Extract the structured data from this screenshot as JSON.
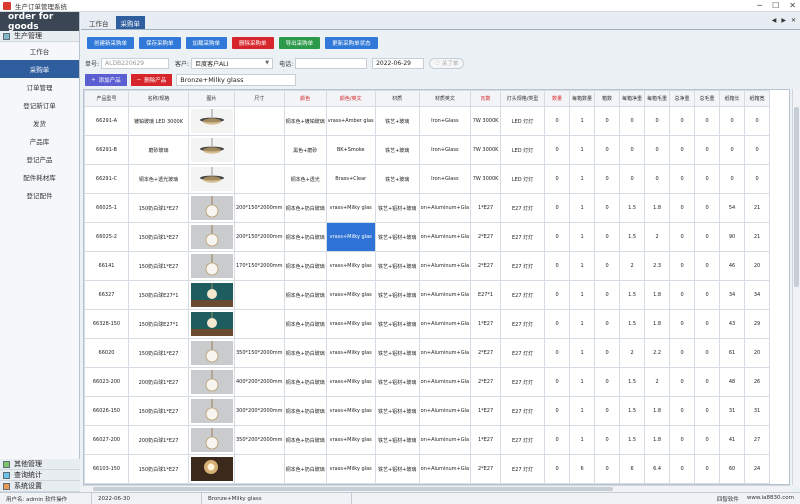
{
  "window": {
    "title": "生产订单管理系统"
  },
  "sidebar": {
    "brand": "order for goods",
    "group_main": "生产管理",
    "items": [
      {
        "label": "工作台"
      },
      {
        "label": "采购单"
      },
      {
        "label": "订单管理"
      },
      {
        "label": "登记新订单"
      },
      {
        "label": "发货"
      },
      {
        "label": "产品库"
      },
      {
        "label": "登记产品"
      },
      {
        "label": "配件耗材库"
      },
      {
        "label": "登记配件"
      }
    ],
    "bottom_groups": [
      {
        "label": "其他管理"
      },
      {
        "label": "查询统计"
      },
      {
        "label": "系统设置"
      }
    ]
  },
  "tabs": [
    {
      "label": "工作台"
    },
    {
      "label": "采购单"
    }
  ],
  "toolbar": {
    "buttons": [
      {
        "label": "创建新采购单"
      },
      {
        "label": "保存采购单"
      },
      {
        "label": "加载采购单"
      },
      {
        "label": "删除采购单"
      },
      {
        "label": "导出采购单"
      },
      {
        "label": "更新采购单状态"
      }
    ]
  },
  "form": {
    "order_no_label": "单号:",
    "order_no_value": "ALDB220629",
    "customer_label": "客户:",
    "customer_value": "巨度客户ALI",
    "phone_label": "电话:",
    "phone_value": "",
    "date_value": "2022-06-29",
    "done_button": "关了单"
  },
  "product": {
    "add_button": "添加产品",
    "delete_button": "删除产品",
    "current_value": "Bronze+Milky glass"
  },
  "table": {
    "headers": [
      "产品型号",
      "名称/规格",
      "图片",
      "尺寸",
      "颜色",
      "颜色/英文",
      "材质",
      "材质英文",
      "瓦数",
      "灯头规格/类型",
      "数量",
      "每箱数量",
      "箱数",
      "每箱净重",
      "每箱毛重",
      "总净重",
      "总毛重",
      "纸箱长",
      "纸箱宽"
    ],
    "red_headers": [
      "颜色",
      "颜色/英文",
      "瓦数",
      "数量"
    ],
    "rows": [
      [
        "66291-A",
        "镀铂玻璃 LED 3000K",
        "img-pendant-dark",
        "",
        "铜本色+镀铂玻璃",
        "vrass+Amber glas",
        "铁艺+玻璃",
        "Iron+Glass",
        "7W 3000K",
        "LED 灯灯",
        "0",
        "1",
        "0",
        "0",
        "0",
        "0",
        "0",
        "0",
        "0"
      ],
      [
        "66291-B",
        "磨砂玻璃",
        "img-pendant-dark",
        "",
        "黑色+磨砂",
        "BK+Smoke",
        "铁艺+玻璃",
        "Iron+Glass",
        "7W 3000K",
        "LED 灯灯",
        "0",
        "1",
        "0",
        "0",
        "0",
        "0",
        "0",
        "0",
        "0"
      ],
      [
        "66291-C",
        "铜本色+透光玻璃",
        "img-pendant-dark",
        "",
        "铜本色+透光",
        "Brass+Clear",
        "铁艺+玻璃",
        "Iron+Glass",
        "7W 3000K",
        "LED 灯灯",
        "0",
        "1",
        "0",
        "0",
        "0",
        "0",
        "0",
        "0",
        "0"
      ],
      [
        "66025-1",
        "150奶白球1*E27",
        "img-globe-light",
        "200*150*2000mm",
        "铜本色+奶白玻璃",
        "vrass+Milky glas",
        "铁艺+铝材+玻璃",
        "on+Aluminum+Gla",
        "1*E27",
        "E27 灯灯",
        "0",
        "1",
        "0",
        "1.5",
        "1.8",
        "0",
        "0",
        "54",
        "21"
      ],
      [
        "66025-2",
        "150奶白球1*E27",
        "img-globe-light",
        "200*150*2000mm",
        "铜本色+奶白玻璃",
        "vrass+Milky glas",
        "铁艺+铝材+玻璃",
        "on+Aluminum+Gla",
        "2*E27",
        "E27 灯灯",
        "0",
        "1",
        "0",
        "1.5",
        "2",
        "0",
        "0",
        "90",
        "21"
      ],
      [
        "66141",
        "150奶白球1*E27",
        "img-globe-light",
        "170*150*2000mm",
        "铜本色+奶白玻璃",
        "vrass+Milky glas",
        "铁艺+铝材+玻璃",
        "on+Aluminum+Gla",
        "2*E27",
        "E27 灯灯",
        "0",
        "1",
        "0",
        "2",
        "2.3",
        "0",
        "0",
        "46",
        "20"
      ],
      [
        "66327",
        "150奶白球E27*1",
        "img-room-teal",
        "",
        "铜本色+奶白玻璃",
        "vrass+Milky glas",
        "铁艺+铝材+玻璃",
        "on+Aluminum+Gla",
        "E27*1",
        "E27 灯灯",
        "0",
        "1",
        "0",
        "1.5",
        "1.8",
        "0",
        "0",
        "34",
        "34"
      ],
      [
        "66328-150",
        "150奶白球E27*1",
        "img-room-teal",
        "",
        "铜本色+奶白玻璃",
        "vrass+Milky glas",
        "铁艺+铝材+玻璃",
        "on+Aluminum+Gla",
        "1*E27",
        "E27 灯灯",
        "0",
        "1",
        "0",
        "1.5",
        "1.8",
        "0",
        "0",
        "43",
        "29"
      ],
      [
        "66020",
        "150奶白球1*E27",
        "img-globe-light",
        "350*150*2000mm",
        "铜本色+奶白玻璃",
        "vrass+Milky glas",
        "铁艺+铝材+玻璃",
        "on+Aluminum+Gla",
        "2*E27",
        "E27 灯灯",
        "0",
        "1",
        "0",
        "2",
        "2.2",
        "0",
        "0",
        "61",
        "20"
      ],
      [
        "66023-200",
        "200奶白球1*E27",
        "img-globe-light",
        "400*200*2000mm",
        "铜本色+奶白玻璃",
        "vrass+Milky glas",
        "铁艺+铝材+玻璃",
        "on+Aluminum+Gla",
        "2*E27",
        "E27 灯灯",
        "0",
        "1",
        "0",
        "1.5",
        "2",
        "0",
        "0",
        "48",
        "26"
      ],
      [
        "66026-150",
        "150奶白球1*E27",
        "img-globe-light",
        "300*200*2000mm",
        "铜本色+奶白玻璃",
        "vrass+Milky glas",
        "铁艺+铝材+玻璃",
        "on+Aluminum+Gla",
        "1*E27",
        "E27 灯灯",
        "0",
        "1",
        "0",
        "1.5",
        "1.8",
        "0",
        "0",
        "31",
        "31"
      ],
      [
        "66027-200",
        "200奶白球1*E27",
        "img-globe-light",
        "350*200*2000mm",
        "铜本色+奶白玻璃",
        "vrass+Milky glas",
        "铁艺+铝材+玻璃",
        "on+Aluminum+Gla",
        "1*E27",
        "E27 灯灯",
        "0",
        "1",
        "0",
        "1.5",
        "1.8",
        "0",
        "0",
        "41",
        "27"
      ],
      [
        "66103-150",
        "150奶白球1*E27",
        "img-room-warm",
        "",
        "铜本色+奶白玻璃",
        "vrass+Milky glas",
        "铁艺+铝材+玻璃",
        "on+Aluminum+Gla",
        "2*E27",
        "E27 灯灯",
        "0",
        "6",
        "0",
        "6",
        "6.4",
        "0",
        "0",
        "60",
        "24"
      ]
    ]
  },
  "status": {
    "user": "用户名: admin 软件操作",
    "date": "2022-06-30",
    "current": "Bronze+Milky glass",
    "brand": "四智软件",
    "site": "www.ia8830.com"
  },
  "colors": {
    "accent": "#2f5e9e",
    "danger": "#d7262b",
    "primary": "#3079d8",
    "success": "#2c9a4a"
  }
}
